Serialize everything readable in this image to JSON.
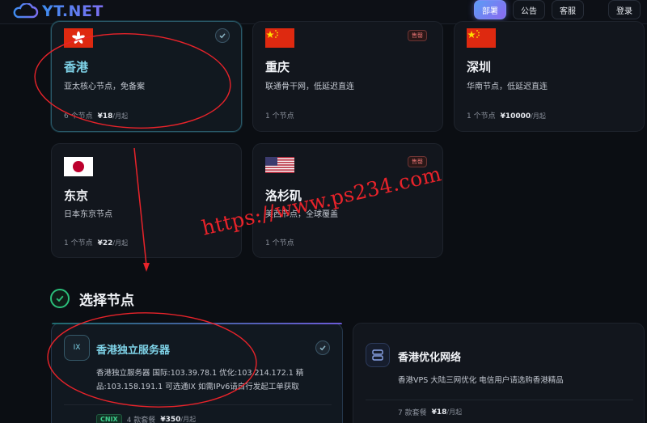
{
  "header": {
    "logo_text": "YT.NET",
    "nav": [
      "部署",
      "公告",
      "客服"
    ],
    "login": "登录"
  },
  "regions": [
    {
      "name": "香港",
      "desc": "亚太核心节点，免备案",
      "nodes": "6 个节点",
      "price": "¥18",
      "unit": "/月起",
      "flag": "hk",
      "selected": true,
      "sold_out": false
    },
    {
      "name": "重庆",
      "desc": "联通骨干网，低延迟直连",
      "nodes": "1 个节点",
      "price": "",
      "unit": "",
      "flag": "cn",
      "selected": false,
      "sold_out": true
    },
    {
      "name": "深圳",
      "desc": "华南节点，低延迟直连",
      "nodes": "1 个节点",
      "price": "¥10000",
      "unit": "/月起",
      "flag": "cn",
      "selected": false,
      "sold_out": false
    },
    {
      "name": "东京",
      "desc": "日本东京节点",
      "nodes": "1 个节点",
      "price": "¥22",
      "unit": "/月起",
      "flag": "jp",
      "selected": false,
      "sold_out": false
    },
    {
      "name": "洛杉矶",
      "desc": "美西节点，全球覆盖",
      "nodes": "1 个节点",
      "price": "",
      "unit": "",
      "flag": "us",
      "selected": false,
      "sold_out": true
    }
  ],
  "sold_out_label": "售罄",
  "section": {
    "title": "选择节点"
  },
  "servers": [
    {
      "badge": "IX",
      "title": "香港独立服务器",
      "desc_line1": "香港独立服务器 国际:103.39.78.1 优化:103.214.172.1 精",
      "desc_line2": "品:103.158.191.1 可选通IX 如需IPv6请自行发起工单获取",
      "tag": "CNIX",
      "plans": "4 款套餐",
      "price": "¥350",
      "unit": "/月起",
      "selected": true
    },
    {
      "title": "香港优化网络",
      "desc_line1": "香港VPS 大陆三网优化 电信用户请选购香港精品",
      "plans": "7 款套餐",
      "price": "¥18",
      "unit": "/月起",
      "selected": false
    }
  ],
  "watermark": "https://www.ps234.com",
  "colors": {
    "accent": "#7fd3e8",
    "annotation": "#e8232a",
    "sold": "#e07070",
    "success": "#2bbf7a"
  },
  "icons": [
    "cloud-logo-icon",
    "check-icon",
    "server-icon"
  ]
}
